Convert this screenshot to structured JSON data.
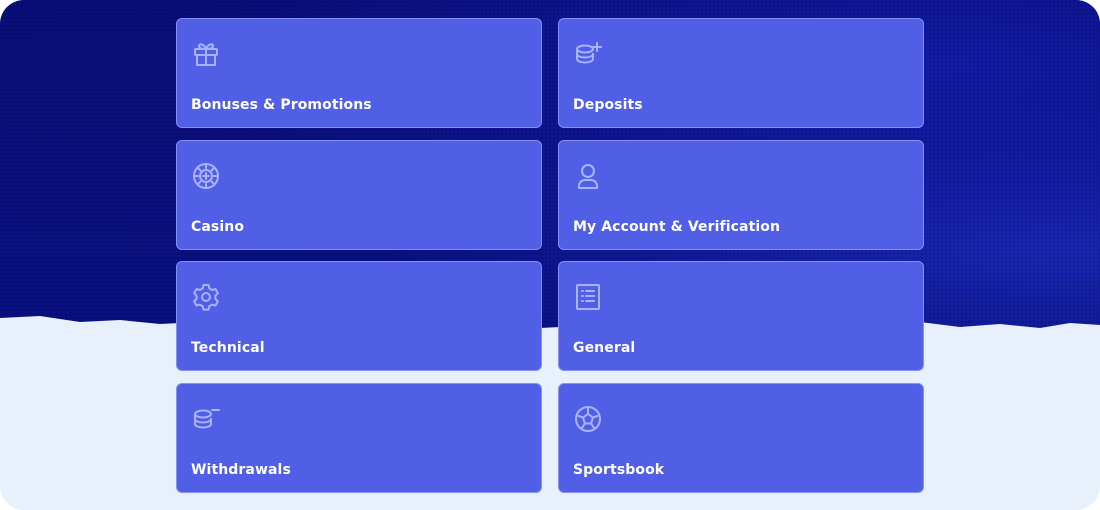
{
  "categories": [
    {
      "label": "Bonuses & Promotions",
      "icon": "gift-icon"
    },
    {
      "label": "Deposits",
      "icon": "coins-add-icon"
    },
    {
      "label": "Casino",
      "icon": "casino-chip-icon"
    },
    {
      "label": "My Account & Verification",
      "icon": "user-icon"
    },
    {
      "label": "Technical",
      "icon": "gear-icon"
    },
    {
      "label": "General",
      "icon": "list-document-icon"
    },
    {
      "label": "Withdrawals",
      "icon": "coins-remove-icon"
    },
    {
      "label": "Sportsbook",
      "icon": "soccer-ball-icon"
    }
  ],
  "colors": {
    "card_background": "#515ee6",
    "icon": "#a9b3ff",
    "banner_dark": "#0a0f86",
    "page_background": "#e8f0fb"
  }
}
